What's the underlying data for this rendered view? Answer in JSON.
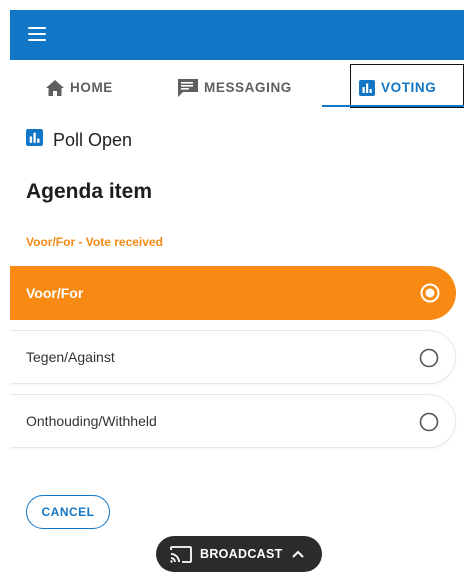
{
  "app": {
    "menu_icon": "hamburger-menu-icon",
    "brand_color": "#1276c6",
    "accent_color": "#f88a13"
  },
  "tabs": [
    {
      "label": "HOME",
      "icon": "home-icon"
    },
    {
      "label": "MESSAGING",
      "icon": "chat-icon"
    },
    {
      "label": "VOTING",
      "icon": "bar-chart-icon",
      "active": true
    }
  ],
  "poll": {
    "status_label": "Poll Open",
    "status_icon": "bar-chart-icon"
  },
  "agenda": {
    "title": "Agenda item",
    "vote_status": "Voor/For - Vote received"
  },
  "options": [
    {
      "label": "Voor/For",
      "selected": true
    },
    {
      "label": "Tegen/Against",
      "selected": false
    },
    {
      "label": "Onthouding/Withheld",
      "selected": false
    }
  ],
  "actions": {
    "cancel_label": "CANCEL"
  },
  "broadcast": {
    "label": "BROADCAST",
    "icon": "cast-icon",
    "chevron_icon": "chevron-up-icon"
  }
}
